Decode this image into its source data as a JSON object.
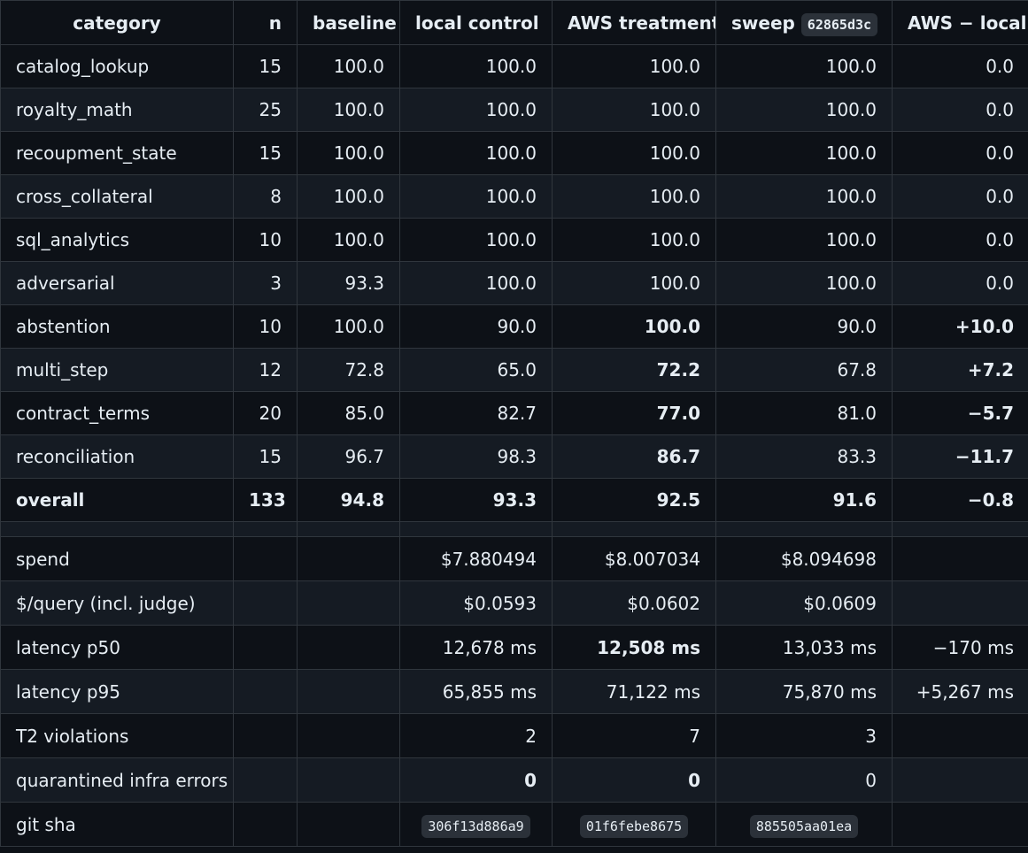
{
  "headers": {
    "category": "category",
    "n": "n",
    "baseline": "baseline",
    "local": "local control",
    "aws": "AWS treatment",
    "sweep": "sweep",
    "sweep_sha": "62865d3c",
    "delta": "AWS − local"
  },
  "rows": [
    {
      "category": "catalog_lookup",
      "n": "15",
      "baseline": "100.0",
      "local": "100.0",
      "aws": "100.0",
      "sweep": "100.0",
      "delta": "0.0"
    },
    {
      "category": "royalty_math",
      "n": "25",
      "baseline": "100.0",
      "local": "100.0",
      "aws": "100.0",
      "sweep": "100.0",
      "delta": "0.0"
    },
    {
      "category": "recoupment_state",
      "n": "15",
      "baseline": "100.0",
      "local": "100.0",
      "aws": "100.0",
      "sweep": "100.0",
      "delta": "0.0"
    },
    {
      "category": "cross_collateral",
      "n": "8",
      "baseline": "100.0",
      "local": "100.0",
      "aws": "100.0",
      "sweep": "100.0",
      "delta": "0.0"
    },
    {
      "category": "sql_analytics",
      "n": "10",
      "baseline": "100.0",
      "local": "100.0",
      "aws": "100.0",
      "sweep": "100.0",
      "delta": "0.0"
    },
    {
      "category": "adversarial",
      "n": "3",
      "baseline": "93.3",
      "local": "100.0",
      "aws": "100.0",
      "sweep": "100.0",
      "delta": "0.0"
    },
    {
      "category": "abstention",
      "n": "10",
      "baseline": "100.0",
      "local": "90.0",
      "aws": "100.0",
      "sweep": "90.0",
      "delta": "+10.0"
    },
    {
      "category": "multi_step",
      "n": "12",
      "baseline": "72.8",
      "local": "65.0",
      "aws": "72.2",
      "sweep": "67.8",
      "delta": "+7.2"
    },
    {
      "category": "contract_terms",
      "n": "20",
      "baseline": "85.0",
      "local": "82.7",
      "aws": "77.0",
      "sweep": "81.0",
      "delta": "−5.7"
    },
    {
      "category": "reconciliation",
      "n": "15",
      "baseline": "96.7",
      "local": "98.3",
      "aws": "86.7",
      "sweep": "83.3",
      "delta": "−11.7"
    },
    {
      "category": "overall",
      "n": "133",
      "baseline": "94.8",
      "local": "93.3",
      "aws": "92.5",
      "sweep": "91.6",
      "delta": "−0.8"
    }
  ],
  "metrics": {
    "spend": {
      "label": "spend",
      "local": "$7.880494",
      "aws": "$8.007034",
      "sweep": "$8.094698",
      "delta": ""
    },
    "per_query": {
      "label": "$/query (incl. judge)",
      "local": "$0.0593",
      "aws": "$0.0602",
      "sweep": "$0.0609",
      "delta": ""
    },
    "p50": {
      "label": "latency p50",
      "local": "12,678 ms",
      "aws": "12,508 ms",
      "sweep": "13,033 ms",
      "delta": "−170 ms"
    },
    "p95": {
      "label": "latency p95",
      "local": "65,855 ms",
      "aws": "71,122 ms",
      "sweep": "75,870 ms",
      "delta": "+5,267 ms"
    },
    "t2": {
      "label": "T2 violations",
      "local": "2",
      "aws": "7",
      "sweep": "3",
      "delta": ""
    },
    "quarantine": {
      "label": "quarantined infra errors",
      "local": "0",
      "aws": "0",
      "sweep": "0",
      "delta": ""
    },
    "git": {
      "label": "git sha",
      "local": "306f13d886a9",
      "aws": "01f6febe8675",
      "sweep": "885505aa01ea",
      "delta": ""
    }
  },
  "colors": {
    "background": "#0d1117",
    "stripe": "#151b23",
    "border": "#30363d",
    "text": "#e6edf3",
    "code_bg": "#2b3139"
  }
}
